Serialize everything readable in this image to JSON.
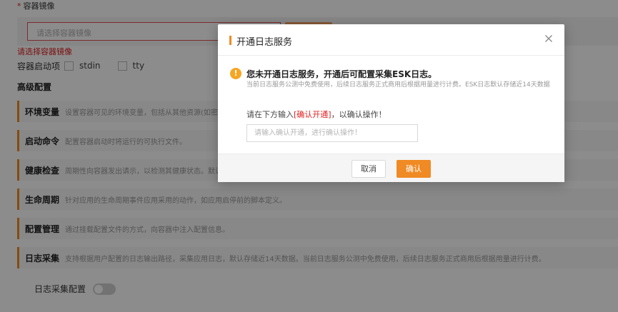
{
  "form": {
    "container_image_label": "容器镜像",
    "required_mark": "*",
    "image_placeholder": "请选择容器镜像",
    "image_error": "请选择容器镜像",
    "startup_options_label": "容器启动项",
    "startup_options": [
      "stdin",
      "tty"
    ],
    "advanced_title": "高级配置",
    "advanced_sections": [
      {
        "title": "环境变量",
        "desc": "设置容器可见的环境变量，包括从其他资源(如密文)"
      },
      {
        "title": "启动命令",
        "desc": "配置容器启动时将运行的可执行文件。"
      },
      {
        "title": "健康检查",
        "desc": "周期性向容器发出请示，以检测其健康状态。默认设"
      },
      {
        "title": "生命周期",
        "desc": "针对应用的生命周期事件应用采用的动作，如应用启停前的脚本定义。"
      },
      {
        "title": "配置管理",
        "desc": "通过挂载配置文件的方式，向容器中注入配置信息。"
      },
      {
        "title": "日志采集",
        "desc": "支持根据用户配置的日志输出路径，采集应用日志，默认存储近14天数据。当前日志服务公测中免费使用，后续日志服务正式商用后根据用量进行计费。"
      }
    ],
    "log_config_label": "日志采集配置",
    "log_config_enabled": false
  },
  "dialog": {
    "title": "开通日志服务",
    "warning_icon": "!",
    "warning_title": "您未开通日志服务，开通后可配置采集ESK日志。",
    "warning_desc": "当前日志服务公测中免费使用，后续日志服务正式商用后根据用量进行计费。ESK日志默认存储近14天数据",
    "prompt_prefix": "请在下方输入",
    "prompt_highlight": "[确认开通]",
    "prompt_suffix": "，以确认操作！",
    "input_placeholder": "请输入确认开通，进行确认操作！",
    "cancel_label": "取消",
    "ok_label": "确认"
  },
  "colors": {
    "accent": "#f08a24",
    "error": "#e02020",
    "warning": "#f5a623"
  }
}
